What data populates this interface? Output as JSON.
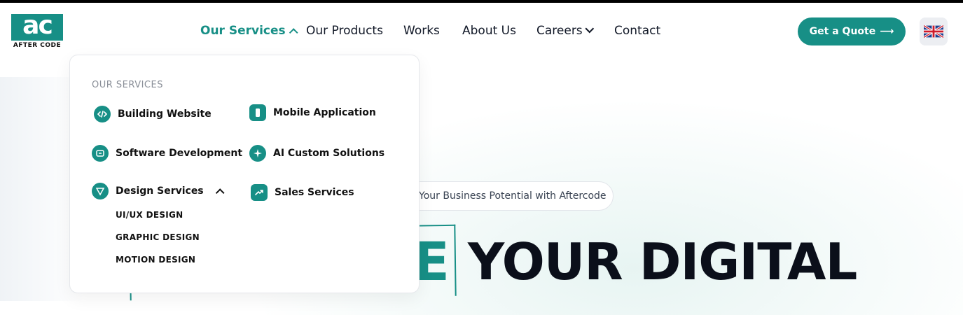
{
  "brand": {
    "logo_mark": "ac",
    "logo_word": "AFTER CODE"
  },
  "nav": {
    "our_services": "Our Services",
    "our_products": "Our Products",
    "works": "Works",
    "about_us": "About Us",
    "careers": "Careers",
    "contact": "Contact"
  },
  "cta": {
    "label": "Get a Quote",
    "arrow": "⟶"
  },
  "language": {
    "flag_icon": "uk-flag-icon"
  },
  "dropdown": {
    "heading": "OUR SERVICES",
    "items": {
      "building_website": "Building Website",
      "mobile_application": "Mobile Application",
      "software_development": "Software Development",
      "ai_custom_solutions": "AI Custom Solutions",
      "design_services": "Design Services",
      "sales_services": "Sales Services"
    },
    "design_subitems": [
      "UI/UX DESIGN",
      "GRAPHIC DESIGN",
      "MOTION DESIGN"
    ]
  },
  "hero": {
    "pill_text": "Your Business Potential with Aftercode",
    "highlight_letter": "E",
    "title_visible": "YOUR DIGITAL"
  },
  "colors": {
    "accent": "#178f86",
    "text": "#111827",
    "muted": "#8a8f98"
  }
}
